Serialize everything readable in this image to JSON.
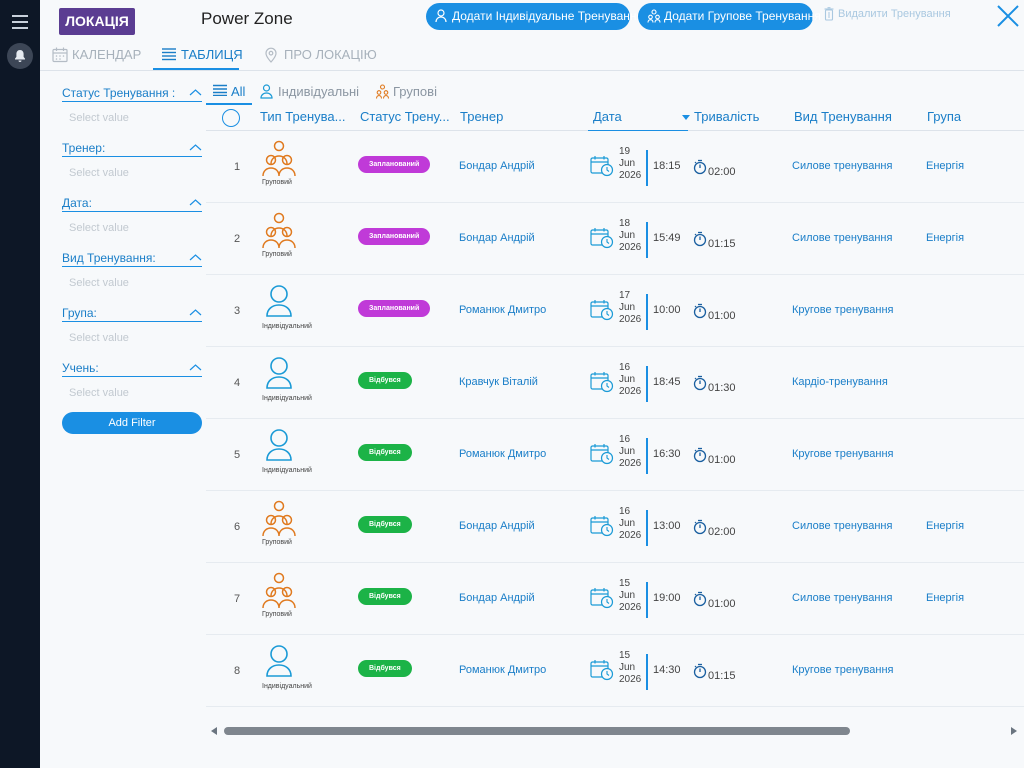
{
  "header": {
    "location_badge": "ЛОКАЦІЯ",
    "location_name": "Power Zone",
    "add_individual": "Додати Індивідуальне Тренування",
    "add_group": "Додати Групове Тренування",
    "delete": "Видалити Тренування"
  },
  "tabs": {
    "calendar": "КАЛЕНДАР",
    "table": "ТАБЛИЦЯ",
    "about": "ПРО ЛОКАЦІЮ"
  },
  "filters": {
    "items": [
      {
        "label": "Статус Тренування :",
        "placeholder": "Select value"
      },
      {
        "label": "Тренер:",
        "placeholder": "Select value"
      },
      {
        "label": "Дата:",
        "placeholder": "Select value"
      },
      {
        "label": "Вид Тренування:",
        "placeholder": "Select value"
      },
      {
        "label": "Група:",
        "placeholder": "Select value"
      },
      {
        "label": "Учень:",
        "placeholder": "Select value"
      }
    ],
    "add_filter": "Add Filter"
  },
  "subtabs": {
    "all": "All",
    "individual": "Індивідуальні",
    "group": "Групові"
  },
  "columns": {
    "type": "Тип Тренува...",
    "status": "Статус Трену...",
    "trainer": "Тренер",
    "date": "Дата",
    "duration": "Тривалість",
    "kind": "Вид Тренування",
    "group": "Група"
  },
  "rows": [
    {
      "num": "1",
      "type": "Груповий",
      "type_kind": "group",
      "status": "Запланований",
      "status_kind": "planned",
      "trainer": "Бондар Андрій",
      "day": "19",
      "month": "Jun",
      "year": "2026",
      "time": "18:15",
      "duration": "02:00",
      "kind": "Силове тренування",
      "group": "Енергія"
    },
    {
      "num": "2",
      "type": "Груповий",
      "type_kind": "group",
      "status": "Запланований",
      "status_kind": "planned",
      "trainer": "Бондар Андрій",
      "day": "18",
      "month": "Jun",
      "year": "2026",
      "time": "15:49",
      "duration": "01:15",
      "kind": "Силове тренування",
      "group": "Енергія"
    },
    {
      "num": "3",
      "type": "Індивідуальний",
      "type_kind": "individual",
      "status": "Запланований",
      "status_kind": "planned",
      "trainer": "Романюк Дмитро",
      "day": "17",
      "month": "Jun",
      "year": "2026",
      "time": "10:00",
      "duration": "01:00",
      "kind": "Кругове тренування",
      "group": ""
    },
    {
      "num": "4",
      "type": "Індивідуальний",
      "type_kind": "individual",
      "status": "Відбувся",
      "status_kind": "done",
      "trainer": "Кравчук Віталій",
      "day": "16",
      "month": "Jun",
      "year": "2026",
      "time": "18:45",
      "duration": "01:30",
      "kind": "Кардіо-тренування",
      "group": ""
    },
    {
      "num": "5",
      "type": "Індивідуальний",
      "type_kind": "individual",
      "status": "Відбувся",
      "status_kind": "done",
      "trainer": "Романюк Дмитро",
      "day": "16",
      "month": "Jun",
      "year": "2026",
      "time": "16:30",
      "duration": "01:00",
      "kind": "Кругове тренування",
      "group": ""
    },
    {
      "num": "6",
      "type": "Груповий",
      "type_kind": "group",
      "status": "Відбувся",
      "status_kind": "done",
      "trainer": "Бондар Андрій",
      "day": "16",
      "month": "Jun",
      "year": "2026",
      "time": "13:00",
      "duration": "02:00",
      "kind": "Силове тренування",
      "group": "Енергія"
    },
    {
      "num": "7",
      "type": "Груповий",
      "type_kind": "group",
      "status": "Відбувся",
      "status_kind": "done",
      "trainer": "Бондар Андрій",
      "day": "15",
      "month": "Jun",
      "year": "2026",
      "time": "19:00",
      "duration": "01:00",
      "kind": "Силове тренування",
      "group": "Енергія"
    },
    {
      "num": "8",
      "type": "Індивідуальний",
      "type_kind": "individual",
      "status": "Відбувся",
      "status_kind": "done",
      "trainer": "Романюк Дмитро",
      "day": "15",
      "month": "Jun",
      "year": "2026",
      "time": "14:30",
      "duration": "01:15",
      "kind": "Кругове тренування",
      "group": ""
    }
  ],
  "colors": {
    "accent": "#1a8fe3",
    "badge_planned": "#c03ad8",
    "badge_done": "#1cb347",
    "location_badge": "#5b3d92",
    "group_icon": "#e07a1f",
    "individual_icon": "#1a9ad6"
  }
}
